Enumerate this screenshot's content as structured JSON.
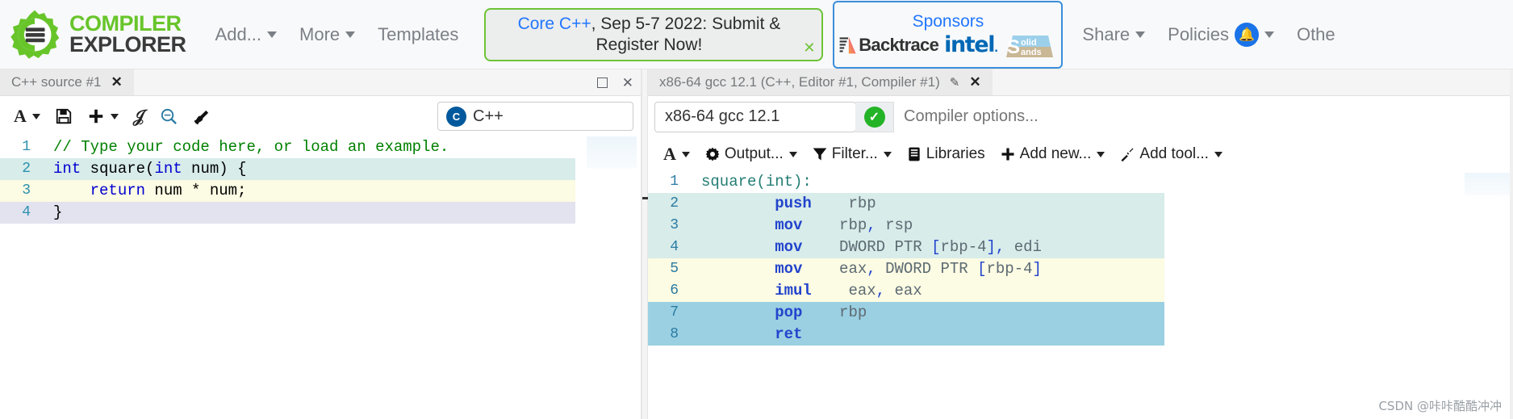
{
  "navbar": {
    "brand": {
      "line1": "COMPILER",
      "line2": "EXPLORER",
      "logo_icon": "gear-c-logo",
      "color": "#67c52a"
    },
    "items": [
      {
        "label": "Add...",
        "has_caret": true
      },
      {
        "label": "More",
        "has_caret": true
      },
      {
        "label": "Templates",
        "has_caret": false
      }
    ],
    "notification": {
      "link_text": "Core C++",
      "rest_text": ", Sep 5-7 2022: Submit & Register Now!",
      "close_icon": "close-icon",
      "border_color": "#6dc437"
    },
    "sponsors": {
      "title": "Sponsors",
      "border_color": "#3a8edc",
      "logos": [
        {
          "name": "Backtrace",
          "text": "Backtrace"
        },
        {
          "name": "intel",
          "text": "intel"
        },
        {
          "name": "Solid Sands",
          "line1": "olid",
          "line2": "ands",
          "big": "S"
        }
      ]
    },
    "right_items": [
      {
        "label": "Share",
        "has_caret": true,
        "badge": null
      },
      {
        "label": "Policies",
        "has_caret": true,
        "badge": "bell-icon"
      },
      {
        "label": "Othe",
        "has_caret": false,
        "badge": null
      }
    ]
  },
  "editor_pane": {
    "tab": {
      "title": "C++ source #1",
      "close_icon": "close-icon"
    },
    "controls": {
      "maximize_icon": "maximize-icon",
      "close_icon": "close-icon"
    },
    "toolbar": [
      {
        "name": "font-size-button",
        "icon": "A-icon",
        "label": "",
        "caret": true
      },
      {
        "name": "save-button",
        "icon": "floppy-icon",
        "label": "",
        "caret": false
      },
      {
        "name": "add-button",
        "icon": "plus-icon",
        "label": "",
        "caret": true
      },
      {
        "name": "vim-mode-button",
        "icon": "vim-icon",
        "label": "",
        "caret": false
      },
      {
        "name": "find-button",
        "icon": "magnifier-icon",
        "label": "",
        "caret": false
      },
      {
        "name": "format-button",
        "icon": "paintbrush-icon",
        "label": "",
        "caret": false
      }
    ],
    "language_select": {
      "value": "C++",
      "icon": "cpp-logo-icon",
      "badge": "C"
    },
    "code_lines": [
      {
        "n": "1",
        "highlight": "white",
        "text": "// Type your code here, or load an example."
      },
      {
        "n": "2",
        "highlight": "green",
        "text": "int square(int num) {"
      },
      {
        "n": "3",
        "highlight": "yellow",
        "text": "    return num * num;"
      },
      {
        "n": "4",
        "highlight": "purple",
        "text": "}"
      }
    ]
  },
  "compiler_pane": {
    "tab": {
      "title": "x86-64 gcc 12.1 (C++, Editor #1, Compiler #1)",
      "edit_icon": "pencil-icon",
      "close_icon": "close-icon"
    },
    "compiler_select": {
      "value": "x86-64 gcc 12.1"
    },
    "status": {
      "icon": "check-circle-icon",
      "color": "#23b327"
    },
    "options_input": {
      "value": "",
      "placeholder": "Compiler options..."
    },
    "toolbar": [
      {
        "name": "font-size-button",
        "icon": "A-icon",
        "label": "",
        "caret": true
      },
      {
        "name": "output-button",
        "icon": "gear-icon",
        "label": "Output...",
        "caret": true
      },
      {
        "name": "filter-button",
        "icon": "funnel-icon",
        "label": "Filter...",
        "caret": true
      },
      {
        "name": "libraries-button",
        "icon": "book-icon",
        "label": "Libraries",
        "caret": false
      },
      {
        "name": "add-new-button",
        "icon": "plus-icon",
        "label": "Add new...",
        "caret": true
      },
      {
        "name": "add-tool-button",
        "icon": "wrench-icon",
        "label": "Add tool...",
        "caret": true
      }
    ],
    "asm_lines": [
      {
        "n": "1",
        "highlight": "white",
        "label": "square(int):",
        "mnemonic": "",
        "operands": ""
      },
      {
        "n": "2",
        "highlight": "green",
        "label": "",
        "mnemonic": "push",
        "operands": "rbp"
      },
      {
        "n": "3",
        "highlight": "green",
        "label": "",
        "mnemonic": "mov",
        "operands": "rbp, rsp"
      },
      {
        "n": "4",
        "highlight": "green",
        "label": "",
        "mnemonic": "mov",
        "operands": "DWORD PTR [rbp-4], edi"
      },
      {
        "n": "5",
        "highlight": "yellow",
        "label": "",
        "mnemonic": "mov",
        "operands": "eax, DWORD PTR [rbp-4]"
      },
      {
        "n": "6",
        "highlight": "yellow",
        "label": "",
        "mnemonic": "imul",
        "operands": "eax, eax"
      },
      {
        "n": "7",
        "highlight": "blue",
        "label": "",
        "mnemonic": "pop",
        "operands": "rbp"
      },
      {
        "n": "8",
        "highlight": "blue",
        "label": "",
        "mnemonic": "ret",
        "operands": ""
      }
    ]
  },
  "watermark": {
    "text": "CSDN @咔咔酷酷冲冲"
  }
}
